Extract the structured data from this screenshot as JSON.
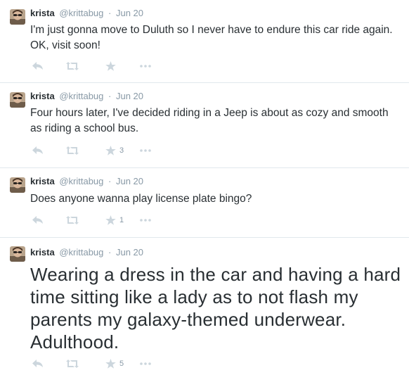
{
  "colors": {
    "text": "#292f33",
    "muted": "#8899a6",
    "icon": "#ccd6dd",
    "divider": "#e1e8ed"
  },
  "tweets": [
    {
      "name": "krista",
      "handle": "@krittabug",
      "separator": "·",
      "date": "Jun 20",
      "text": "I'm just gonna move to Duluth so I never have to endure this car ride again. OK, visit soon!",
      "favorites": "",
      "icons": [
        "reply-icon",
        "retweet-icon",
        "favorite-icon",
        "more-icon"
      ]
    },
    {
      "name": "krista",
      "handle": "@krittabug",
      "separator": "·",
      "date": "Jun 20",
      "text": "Four hours later, I've decided riding in a Jeep is about as cozy and smooth as riding a school bus.",
      "favorites": "3",
      "icons": [
        "reply-icon",
        "retweet-icon",
        "favorite-icon",
        "more-icon"
      ]
    },
    {
      "name": "krista",
      "handle": "@krittabug",
      "separator": "·",
      "date": "Jun 20",
      "text": "Does anyone wanna play license plate bingo?",
      "favorites": "1",
      "icons": [
        "reply-icon",
        "retweet-icon",
        "favorite-icon",
        "more-icon"
      ]
    },
    {
      "name": "krista",
      "handle": "@krittabug",
      "separator": "·",
      "date": "Jun 20",
      "text": "Wearing a dress in the car and having a hard time sitting like a lady as to not flash my parents my galaxy-themed underwear. Adulthood.",
      "favorites": "5",
      "icons": [
        "reply-icon",
        "retweet-icon",
        "favorite-icon",
        "more-icon"
      ]
    }
  ]
}
